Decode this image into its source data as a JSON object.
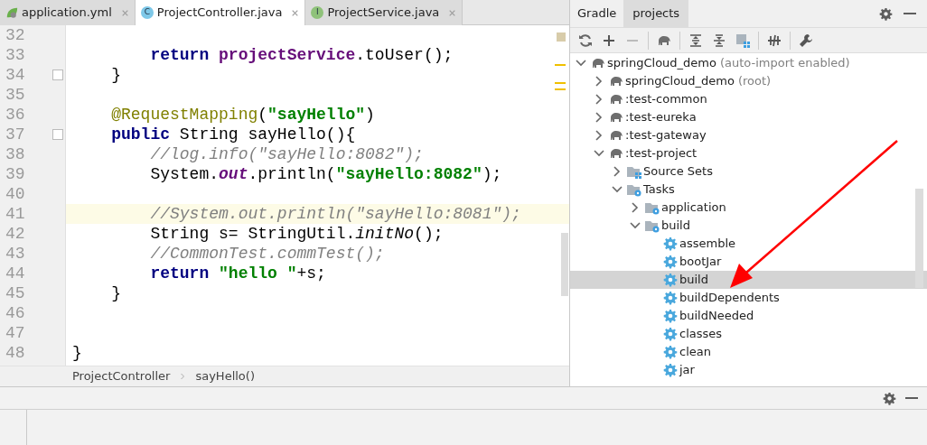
{
  "editor": {
    "tabs": [
      {
        "label": "application.yml",
        "kind": "config",
        "selected": false
      },
      {
        "label": "ProjectController.java",
        "kind": "class",
        "icon_letter": "C",
        "selected": true
      },
      {
        "label": "ProjectService.java",
        "kind": "interface",
        "icon_letter": "I",
        "selected": false
      }
    ],
    "lines": [
      {
        "number": "32",
        "current": false,
        "fold": false
      },
      {
        "number": "33",
        "current": false,
        "fold": false,
        "tokens": [
          {
            "kind": "keyword",
            "text": "        return "
          },
          {
            "kind": "field",
            "text": "projectService"
          },
          {
            "kind": "plain",
            "text": ".toUser();"
          }
        ]
      },
      {
        "number": "34",
        "current": false,
        "fold": true,
        "tokens": [
          {
            "kind": "plain",
            "text": "    }"
          }
        ]
      },
      {
        "number": "35",
        "current": false,
        "fold": false
      },
      {
        "number": "36",
        "current": false,
        "fold": false,
        "tokens": [
          {
            "kind": "annotation",
            "text": "    @RequestMapping"
          },
          {
            "kind": "plain",
            "text": "("
          },
          {
            "kind": "string",
            "text": "\"sayHello\""
          },
          {
            "kind": "plain",
            "text": ")"
          }
        ]
      },
      {
        "number": "37",
        "current": false,
        "fold": true,
        "tokens": [
          {
            "kind": "keyword",
            "text": "    public"
          },
          {
            "kind": "plain",
            "text": " String sayHello(){"
          }
        ]
      },
      {
        "number": "38",
        "current": false,
        "fold": false,
        "tokens": [
          {
            "kind": "comment",
            "text": "        //log.info(\"sayHello:8082\");"
          }
        ]
      },
      {
        "number": "39",
        "current": false,
        "fold": false,
        "tokens": [
          {
            "kind": "plain",
            "text": "        System."
          },
          {
            "kind": "static_field",
            "text": "out"
          },
          {
            "kind": "plain",
            "text": ".println("
          },
          {
            "kind": "string",
            "text": "\"sayHello:8082\""
          },
          {
            "kind": "plain",
            "text": ");"
          }
        ]
      },
      {
        "number": "40",
        "current": false,
        "fold": false
      },
      {
        "number": "41",
        "current": true,
        "fold": false,
        "tokens": [
          {
            "kind": "comment",
            "text": "        //System.out.println(\"sayHello:8081\");"
          }
        ]
      },
      {
        "number": "42",
        "current": false,
        "fold": false,
        "tokens": [
          {
            "kind": "plain",
            "text": "        String s= StringUtil."
          },
          {
            "kind": "static_method",
            "text": "initNo"
          },
          {
            "kind": "plain",
            "text": "();"
          }
        ]
      },
      {
        "number": "43",
        "current": false,
        "fold": false,
        "tokens": [
          {
            "kind": "comment",
            "text": "        //CommonTest.commTest();"
          }
        ]
      },
      {
        "number": "44",
        "current": false,
        "fold": false,
        "tokens": [
          {
            "kind": "keyword",
            "text": "        return "
          },
          {
            "kind": "string",
            "text": "\"hello \""
          },
          {
            "kind": "plain",
            "text": "+s;"
          }
        ]
      },
      {
        "number": "45",
        "current": false,
        "fold": false,
        "tokens": [
          {
            "kind": "plain",
            "text": "    }"
          }
        ]
      },
      {
        "number": "46",
        "current": false,
        "fold": false
      },
      {
        "number": "47",
        "current": false,
        "fold": false
      },
      {
        "number": "48",
        "current": false,
        "fold": false,
        "tokens": [
          {
            "kind": "plain",
            "text": "}"
          }
        ]
      }
    ],
    "breadcrumb": [
      "ProjectController",
      "sayHello()"
    ]
  },
  "gradle": {
    "title": "Gradle",
    "tabs": [
      {
        "label": "projects",
        "selected": true
      }
    ],
    "tree": [
      {
        "label": "springCloud_demo",
        "note": "(auto-import enabled)",
        "kind": "project",
        "expanded": true,
        "selected": false,
        "children": [
          {
            "label": "springCloud_demo",
            "note": "(root)",
            "kind": "project",
            "expanded": false,
            "selected": false
          },
          {
            "label": ":test-common",
            "kind": "project",
            "expanded": false,
            "selected": false
          },
          {
            "label": ":test-eureka",
            "kind": "project",
            "expanded": false,
            "selected": false
          },
          {
            "label": ":test-gateway",
            "kind": "project",
            "expanded": false,
            "selected": false
          },
          {
            "label": ":test-project",
            "kind": "project",
            "expanded": true,
            "selected": false,
            "children": [
              {
                "label": "Source Sets",
                "kind": "sourceset",
                "expanded": false,
                "selected": false
              },
              {
                "label": "Tasks",
                "kind": "taskfolder",
                "expanded": true,
                "selected": false,
                "children": [
                  {
                    "label": "application",
                    "kind": "taskfolder",
                    "expanded": false,
                    "selected": false
                  },
                  {
                    "label": "build",
                    "kind": "taskfolder",
                    "expanded": true,
                    "selected": false,
                    "children": [
                      {
                        "label": "assemble",
                        "kind": "task",
                        "selected": false
                      },
                      {
                        "label": "bootJar",
                        "kind": "task",
                        "selected": false
                      },
                      {
                        "label": "build",
                        "kind": "task",
                        "selected": true
                      },
                      {
                        "label": "buildDependents",
                        "kind": "task",
                        "selected": false
                      },
                      {
                        "label": "buildNeeded",
                        "kind": "task",
                        "selected": false
                      },
                      {
                        "label": "classes",
                        "kind": "task",
                        "selected": false
                      },
                      {
                        "label": "clean",
                        "kind": "task",
                        "selected": false
                      },
                      {
                        "label": "jar",
                        "kind": "task",
                        "selected": false
                      }
                    ]
                  }
                ]
              }
            ]
          }
        ]
      }
    ]
  }
}
